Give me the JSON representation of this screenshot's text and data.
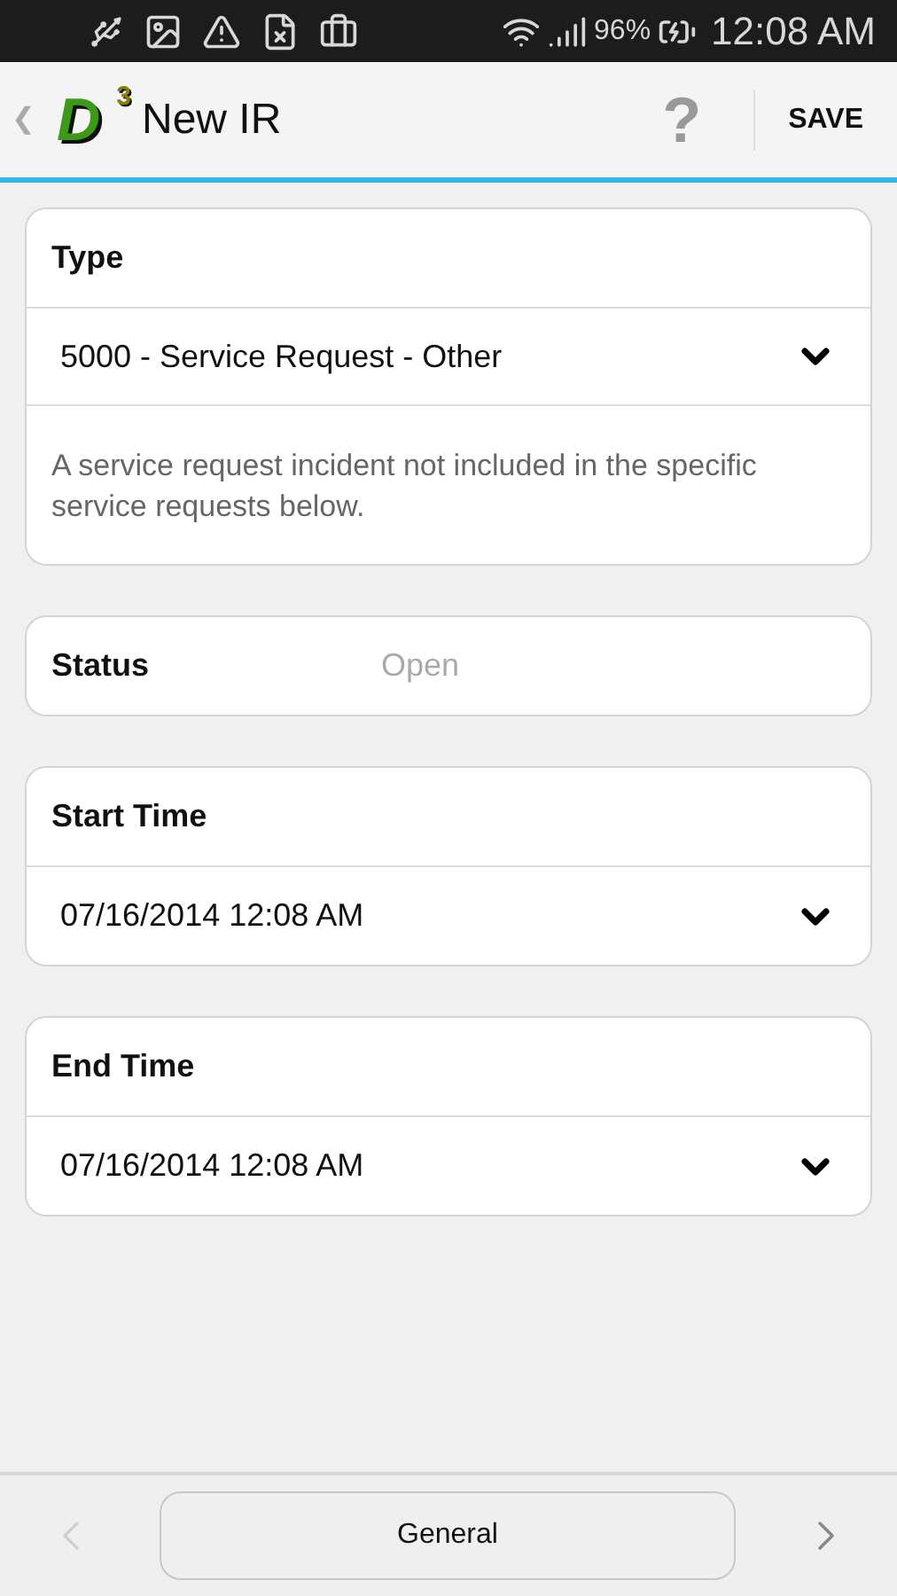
{
  "status_bar": {
    "battery": "96%",
    "time": "12:08 AM"
  },
  "app_bar": {
    "back": "❮",
    "logo": {
      "letter": "D",
      "sup": "3"
    },
    "title": "New IR",
    "help": "?",
    "save": "SAVE"
  },
  "sections": [
    {
      "kind": "select",
      "label": "Type",
      "value": "5000 - Service Request - Other",
      "description": "A service request incident not included in the specific service requests below."
    },
    {
      "kind": "inline",
      "label": "Status",
      "value": "Open"
    },
    {
      "kind": "select",
      "label": "Start Time",
      "value": "07/16/2014 12:08 AM"
    },
    {
      "kind": "select",
      "label": "End Time",
      "value": "07/16/2014 12:08 AM"
    }
  ],
  "bottom_bar": {
    "prev": {
      "disabled": true
    },
    "page": "General",
    "next": {
      "disabled": false
    }
  }
}
